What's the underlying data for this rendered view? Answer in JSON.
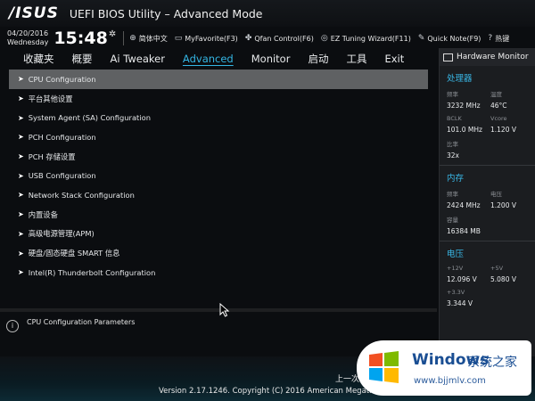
{
  "titlebar": {
    "logo": "/ISUS",
    "title": "UEFI BIOS Utility – Advanced Mode"
  },
  "infobar": {
    "date": "04/20/2016",
    "weekday": "Wednesday",
    "time": "15:48",
    "tools": [
      {
        "icon": "globe-icon",
        "label": "简体中文"
      },
      {
        "icon": "favorite-icon",
        "label": "MyFavorite(F3)"
      },
      {
        "icon": "fan-icon",
        "label": "Qfan Control(F6)"
      },
      {
        "icon": "wizard-icon",
        "label": "EZ Tuning Wizard(F11)"
      },
      {
        "icon": "note-icon",
        "label": "Quick Note(F9)"
      },
      {
        "icon": "help-icon",
        "label": "热键"
      }
    ]
  },
  "menu": {
    "tabs": [
      "收藏夹",
      "概要",
      "Ai Tweaker",
      "Advanced",
      "Monitor",
      "启动",
      "工具",
      "Exit"
    ],
    "active": "Advanced"
  },
  "main": {
    "items": [
      "CPU Configuration",
      "平台其他设置",
      "System Agent (SA) Configuration",
      "PCH Configuration",
      "PCH 存储设置",
      "USB Configuration",
      "Network Stack Configuration",
      "内置设备",
      "高级电源管理(APM)",
      "硬盘/固态硬盘 SMART 信息",
      "Intel(R) Thunderbolt Configuration"
    ]
  },
  "help": {
    "text": "CPU Configuration Parameters"
  },
  "hwmon": {
    "title": "Hardware Monitor",
    "cpu": {
      "heading": "处理器",
      "freq_label": "频率",
      "freq": "3232 MHz",
      "temp_label": "温度",
      "temp": "46°C",
      "bclk_label": "BCLK",
      "bclk": "101.0 MHz",
      "vcore_label": "Vcore",
      "vcore": "1.120 V",
      "ratio_label": "比率",
      "ratio": "32x"
    },
    "memory": {
      "heading": "内存",
      "freq_label": "频率",
      "freq": "2424 MHz",
      "volt_label": "电压",
      "volt": "1.200 V",
      "cap_label": "容量",
      "cap": "16384 MB"
    },
    "voltage": {
      "heading": "电压",
      "v12_label": "+12V",
      "v12": "12.096 V",
      "v5_label": "+5V",
      "v5": "5.080 V",
      "v33_label": "+3.3V",
      "v33": "3.344 V"
    }
  },
  "footer": {
    "nav": "上一次",
    "copyright": "Version 2.17.1246. Copyright (C) 2016 American Megatrends, Inc."
  },
  "watermark": {
    "brand": "Windows",
    "cn": "系统之家",
    "url": "www.bjjmlv.com"
  }
}
